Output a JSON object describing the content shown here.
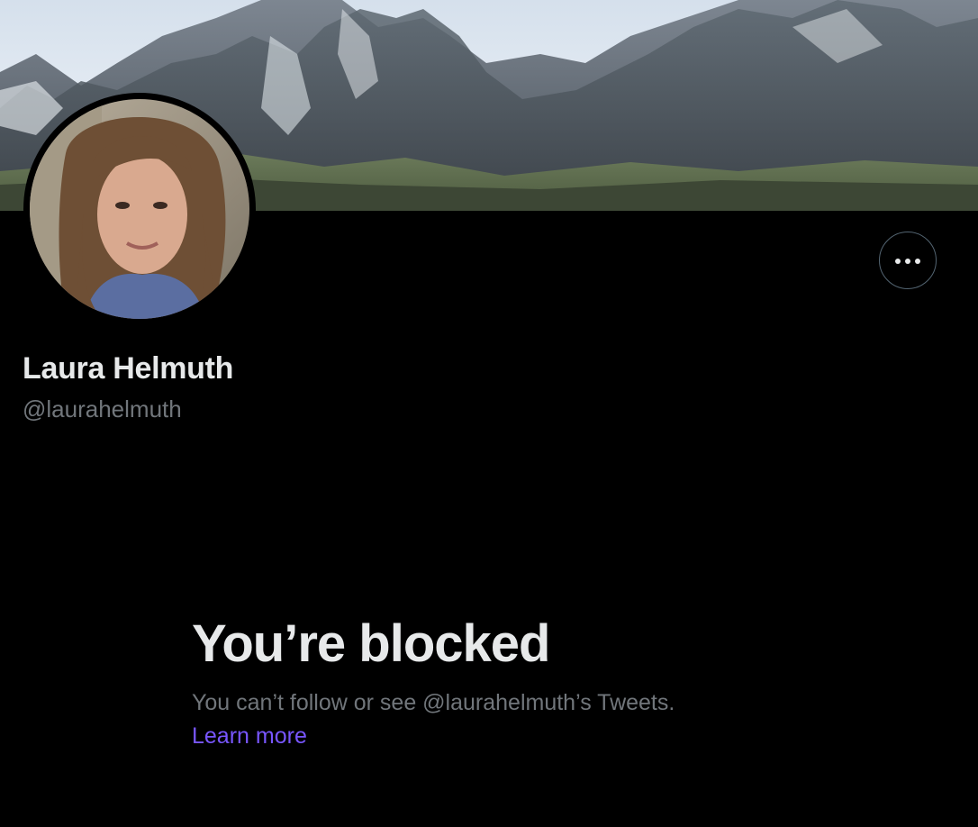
{
  "profile": {
    "display_name": "Laura Helmuth",
    "handle": "@laurahelmuth",
    "banner_image": "mountain-landscape",
    "avatar_image": "profile-photo"
  },
  "actions": {
    "more_icon": "more-horizontal-icon"
  },
  "blocked": {
    "title": "You’re blocked",
    "description": "You can’t follow or see @laurahelmuth’s Tweets.",
    "learn_more": "Learn more"
  },
  "colors": {
    "background": "#000000",
    "primary_text": "#e7e9ea",
    "secondary_text": "#71767b",
    "link": "#7856ff",
    "border": "#536471"
  }
}
